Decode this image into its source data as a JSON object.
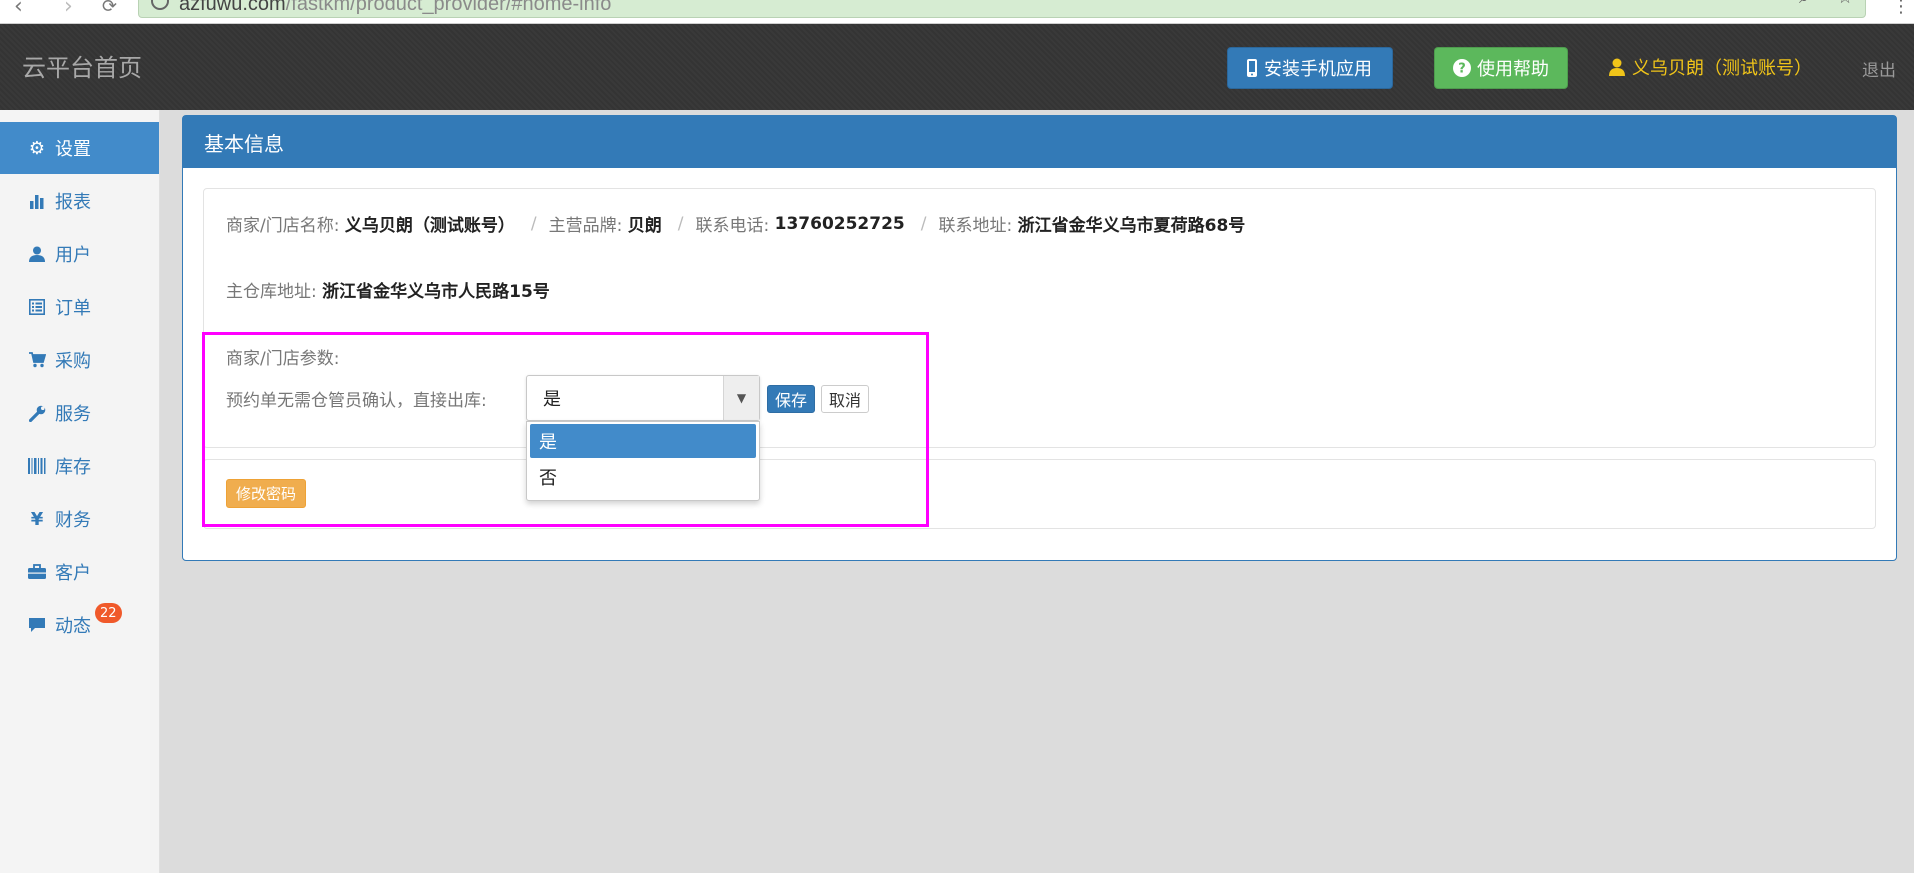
{
  "browser": {
    "url_host": "azfuwu.com",
    "url_path": "/fastkm/product_provider/#home-info"
  },
  "navbar": {
    "brand": "云平台首页",
    "install_button": "安装手机应用",
    "help_button": "使用帮助",
    "user": "义乌贝朗（测试账号）",
    "logout": "退出"
  },
  "sidebar": {
    "items": [
      {
        "label": "设置",
        "icon": "gear-icon",
        "active": true
      },
      {
        "label": "报表",
        "icon": "bar-chart-icon"
      },
      {
        "label": "用户",
        "icon": "user-icon"
      },
      {
        "label": "订单",
        "icon": "list-alt-icon"
      },
      {
        "label": "采购",
        "icon": "shopping-cart-icon"
      },
      {
        "label": "服务",
        "icon": "wrench-icon"
      },
      {
        "label": "库存",
        "icon": "barcode-icon"
      },
      {
        "label": "财务",
        "icon": "yen-icon"
      },
      {
        "label": "客户",
        "icon": "briefcase-icon"
      },
      {
        "label": "动态",
        "icon": "comment-icon",
        "badge": "22"
      }
    ]
  },
  "panel": {
    "heading": "基本信息",
    "info": {
      "store_name_label": "商家/门店名称:",
      "store_name": "义乌贝朗（测试账号）",
      "brand_label": "主营品牌:",
      "brand": "贝朗",
      "phone_label": "联系电话:",
      "phone": "13760252725",
      "address_label": "联系地址:",
      "address": "浙江省金华义乌市夏荷路68号",
      "warehouse_label": "主仓库地址:",
      "warehouse": "浙江省金华义乌市人民路15号"
    },
    "params": {
      "title": "商家/门店参数:",
      "confirm_label": "预约单无需仓管员确认，直接出库:",
      "select_value": "是",
      "options": [
        "是",
        "否"
      ],
      "save_button": "保存",
      "cancel_button": "取消"
    },
    "change_password_button": "修改密码"
  },
  "colors": {
    "primary": "#337ab7",
    "success": "#5cb85c",
    "warning": "#f0ad4e",
    "highlight": "#ff00ff",
    "user_text": "#f0c419",
    "badge": "#f0592a"
  }
}
